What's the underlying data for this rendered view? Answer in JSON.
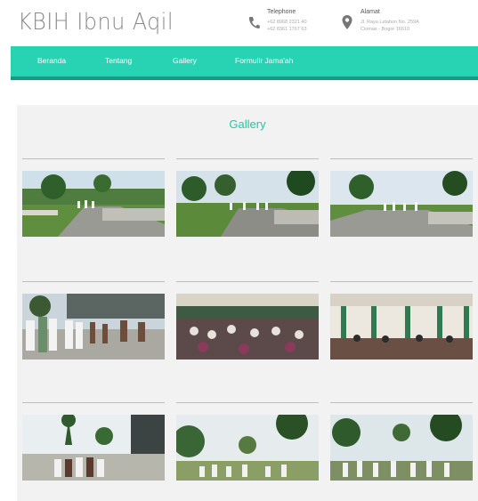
{
  "header": {
    "logo_text": "KBIH Ibnu Aqil",
    "phone": {
      "icon": "phone-icon",
      "label": "Telephone",
      "line1": "+62 8968 2321 40",
      "line2": "+62 8361 1767 63"
    },
    "address": {
      "icon": "map-pin-icon",
      "label": "Alamat",
      "line1": "Jl. Raya Letabon No. 259A",
      "line2": "Ciomas - Bogor 16610"
    }
  },
  "nav": {
    "items": [
      {
        "label": "Beranda"
      },
      {
        "label": "Tentang"
      },
      {
        "label": "Gallery"
      },
      {
        "label": "Formulir Jama'ah"
      }
    ]
  },
  "gallery": {
    "title": "Gallery",
    "photos": [
      {
        "scene": "outdoor-plaza"
      },
      {
        "scene": "outdoor-plaza"
      },
      {
        "scene": "outdoor-plaza"
      },
      {
        "scene": "outdoor-group"
      },
      {
        "scene": "indoor-hall"
      },
      {
        "scene": "indoor-hall"
      },
      {
        "scene": "outdoor-group"
      },
      {
        "scene": "outdoor-group"
      },
      {
        "scene": "outdoor-group"
      }
    ]
  },
  "colors": {
    "accent": "#27d3b2",
    "accent_dark": "#129c84",
    "title": "#27c4a6"
  }
}
